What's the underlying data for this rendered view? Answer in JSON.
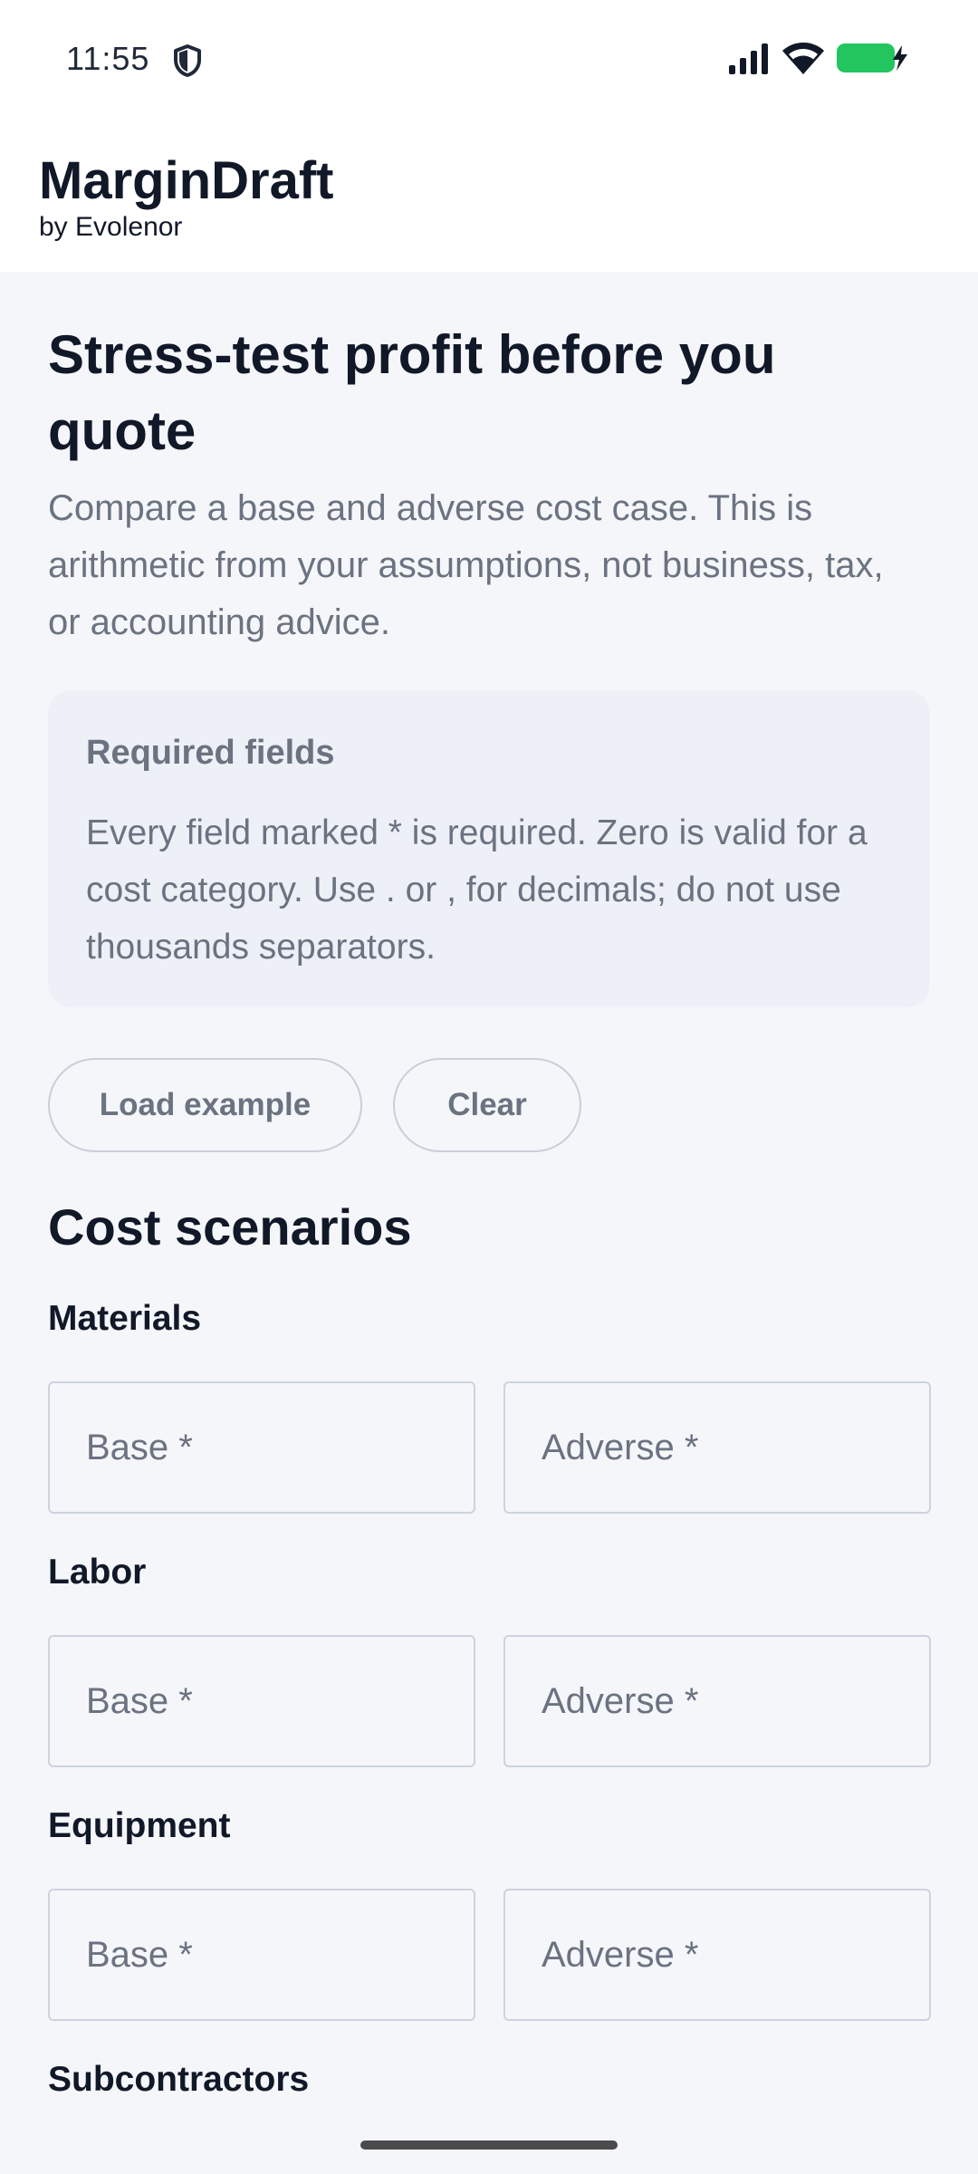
{
  "status_bar": {
    "time": "11:55",
    "icons": [
      "shield-icon",
      "signal-icon",
      "wifi-icon",
      "battery-charging-icon"
    ],
    "battery_color": "#22c55e"
  },
  "header": {
    "title": "MarginDraft",
    "subtitle": "by Evolenor"
  },
  "hero": {
    "title": "Stress-test profit before you quote",
    "description": "Compare a base and adverse cost case. This is arithmetic from your assumptions, not business, tax, or accounting advice."
  },
  "info_card": {
    "title": "Required fields",
    "text": "Every field marked * is required. Zero is valid for a cost category. Use . or , for decimals; do not use thousands separators."
  },
  "actions": {
    "load_example": "Load example",
    "clear": "Clear"
  },
  "cost_scenarios": {
    "title": "Cost scenarios",
    "categories": [
      {
        "label": "Materials",
        "base_placeholder": "Base *",
        "adverse_placeholder": "Adverse *",
        "base_value": "",
        "adverse_value": ""
      },
      {
        "label": "Labor",
        "base_placeholder": "Base *",
        "adverse_placeholder": "Adverse *",
        "base_value": "",
        "adverse_value": ""
      },
      {
        "label": "Equipment",
        "base_placeholder": "Base *",
        "adverse_placeholder": "Adverse *",
        "base_value": "",
        "adverse_value": ""
      },
      {
        "label": "Subcontractors"
      }
    ]
  }
}
